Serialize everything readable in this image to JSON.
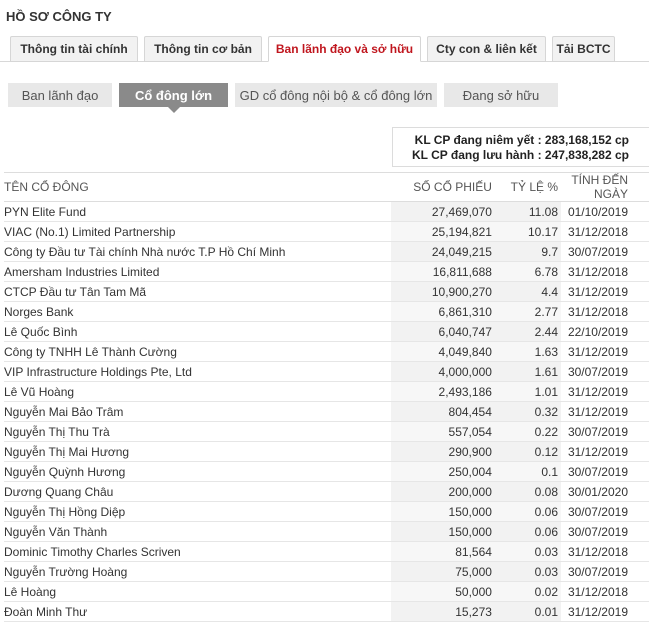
{
  "header": {
    "title": "HỒ SƠ CÔNG TY"
  },
  "tabs": [
    {
      "label": "Thông tin tài chính",
      "active": false
    },
    {
      "label": "Thông tin cơ bản",
      "active": false
    },
    {
      "label": "Ban lãnh đạo và sở hữu",
      "active": true
    },
    {
      "label": "Cty con & liên kết",
      "active": false
    },
    {
      "label": "Tải BCTC",
      "active": false
    }
  ],
  "subtabs": [
    {
      "label": "Ban lãnh đạo",
      "active": false
    },
    {
      "label": "Cổ đông lớn",
      "active": true
    },
    {
      "label": "GD cổ đông nội bộ & cổ đông lớn",
      "active": false
    },
    {
      "label": "Đang sở hữu",
      "active": false
    }
  ],
  "summary": {
    "listed_label": "KL CP đang niêm yết :",
    "listed_value": "283,168,152 cp",
    "outstanding_label": "KL CP đang lưu hành :",
    "outstanding_value": "247,838,282 cp"
  },
  "table": {
    "headers": {
      "name": "TÊN CỔ ĐÔNG",
      "shares": "SỐ CỔ PHIẾU",
      "pct": "TỶ LỆ %",
      "date": "TÍNH ĐẾN NGÀY"
    },
    "rows": [
      {
        "name": "PYN Elite Fund",
        "shares": "27,469,070",
        "pct": "11.08",
        "date": "01/10/2019"
      },
      {
        "name": "VIAC (No.1) Limited Partnership",
        "shares": "25,194,821",
        "pct": "10.17",
        "date": "31/12/2018"
      },
      {
        "name": "Công ty Đầu tư Tài chính Nhà nước T.P Hồ Chí Minh",
        "shares": "24,049,215",
        "pct": "9.7",
        "date": "30/07/2019"
      },
      {
        "name": "Amersham Industries Limited",
        "shares": "16,811,688",
        "pct": "6.78",
        "date": "31/12/2018"
      },
      {
        "name": "CTCP Đầu tư Tân Tam Mã",
        "shares": "10,900,270",
        "pct": "4.4",
        "date": "31/12/2019"
      },
      {
        "name": "Norges Bank",
        "shares": "6,861,310",
        "pct": "2.77",
        "date": "31/12/2018"
      },
      {
        "name": "Lê Quốc Bình",
        "shares": "6,040,747",
        "pct": "2.44",
        "date": "22/10/2019"
      },
      {
        "name": "Công ty TNHH Lê Thành Cường",
        "shares": "4,049,840",
        "pct": "1.63",
        "date": "31/12/2019"
      },
      {
        "name": "VIP Infrastructure Holdings Pte, Ltd",
        "shares": "4,000,000",
        "pct": "1.61",
        "date": "30/07/2019"
      },
      {
        "name": "Lê Vũ Hoàng",
        "shares": "2,493,186",
        "pct": "1.01",
        "date": "31/12/2019"
      },
      {
        "name": "Nguyễn Mai Bảo Trâm",
        "shares": "804,454",
        "pct": "0.32",
        "date": "31/12/2019"
      },
      {
        "name": "Nguyễn Thị Thu Trà",
        "shares": "557,054",
        "pct": "0.22",
        "date": "30/07/2019"
      },
      {
        "name": "Nguyễn Thị Mai Hương",
        "shares": "290,900",
        "pct": "0.12",
        "date": "31/12/2019"
      },
      {
        "name": "Nguyễn Quỳnh Hương",
        "shares": "250,004",
        "pct": "0.1",
        "date": "30/07/2019"
      },
      {
        "name": "Dương Quang Châu",
        "shares": "200,000",
        "pct": "0.08",
        "date": "30/01/2020"
      },
      {
        "name": "Nguyễn Thị Hồng Diệp",
        "shares": "150,000",
        "pct": "0.06",
        "date": "30/07/2019"
      },
      {
        "name": "Nguyễn Văn Thành",
        "shares": "150,000",
        "pct": "0.06",
        "date": "30/07/2019"
      },
      {
        "name": "Dominic Timothy Charles Scriven",
        "shares": "81,564",
        "pct": "0.03",
        "date": "31/12/2018"
      },
      {
        "name": "Nguyễn Trường Hoàng",
        "shares": "75,000",
        "pct": "0.03",
        "date": "30/07/2019"
      },
      {
        "name": "Lê Hoàng",
        "shares": "50,000",
        "pct": "0.02",
        "date": "31/12/2018"
      },
      {
        "name": "Đoàn Minh Thư",
        "shares": "15,273",
        "pct": "0.01",
        "date": "31/12/2019"
      }
    ]
  },
  "colors": {
    "active_tab_text": "#c0161e",
    "active_subtab_bg": "#8a8a8a"
  }
}
